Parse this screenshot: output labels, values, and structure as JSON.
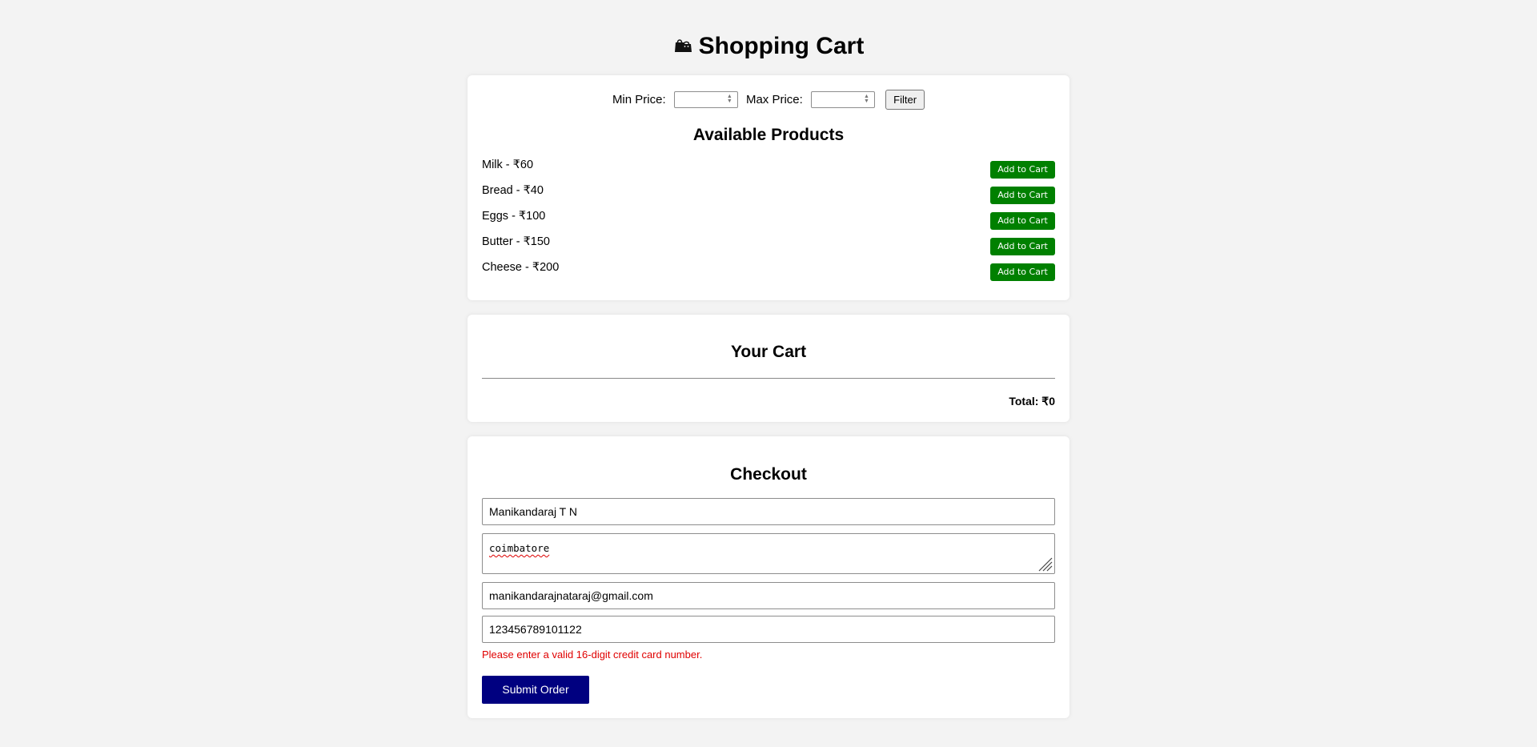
{
  "header": {
    "title": "Shopping Cart",
    "icon": "shopping-bags-icon"
  },
  "filter": {
    "min_label": "Min Price:",
    "max_label": "Max Price:",
    "min_value": "",
    "max_value": "",
    "button_label": "Filter"
  },
  "products": {
    "title": "Available Products",
    "button_label": "Add to Cart",
    "button_color": "#008000",
    "items": [
      {
        "label": "Milk - ₹60"
      },
      {
        "label": "Bread - ₹40"
      },
      {
        "label": "Eggs - ₹100"
      },
      {
        "label": "Butter - ₹150"
      },
      {
        "label": "Cheese - ₹200"
      }
    ]
  },
  "cart": {
    "title": "Your Cart",
    "total": "Total: ₹0"
  },
  "checkout": {
    "title": "Checkout",
    "name_value": "Manikandaraj T N",
    "address_value": "coimbatore",
    "email_value": "manikandarajnataraj@gmail.com",
    "card_value": "123456789101122",
    "error": "Please enter a valid 16-digit credit card number.",
    "error_color": "#e00000",
    "submit_label": "Submit Order",
    "submit_color": "#000080"
  }
}
